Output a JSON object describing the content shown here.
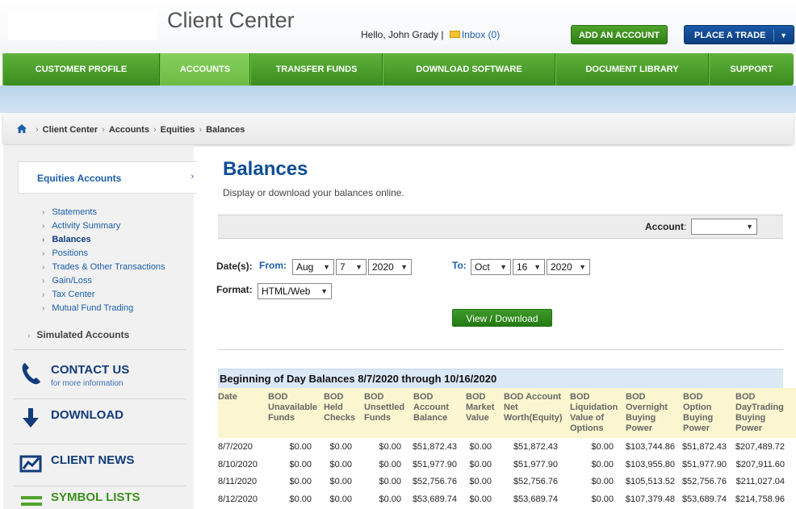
{
  "header": {
    "app_title": "Client Center",
    "welcome": "Hello, John Grady |",
    "inbox_label": "Inbox (0)",
    "add_account_label": "ADD AN ACCOUNT",
    "place_trade_label": "PLACE A TRADE"
  },
  "nav": {
    "items": [
      {
        "label": "CUSTOMER PROFILE"
      },
      {
        "label": "ACCOUNTS"
      },
      {
        "label": "TRANSFER FUNDS"
      },
      {
        "label": "DOWNLOAD SOFTWARE"
      },
      {
        "label": "DOCUMENT LIBRARY"
      },
      {
        "label": "SUPPORT"
      }
    ]
  },
  "breadcrumb": [
    "Client Center",
    "Accounts",
    "Equities",
    "Balances"
  ],
  "sidebar": {
    "section_title": "Equities Accounts",
    "links": [
      "Statements",
      "Activity Summary",
      "Balances",
      "Positions",
      "Trades & Other Transactions",
      "Gain/Loss",
      "Tax Center",
      "Mutual Fund Trading"
    ],
    "simulated": "Simulated Accounts",
    "promos": {
      "contact_title": "CONTACT US",
      "contact_sub": "for more information",
      "download_title": "DOWNLOAD",
      "news_title": "CLIENT NEWS",
      "symbols_title": "SYMBOL LISTS"
    }
  },
  "main": {
    "title": "Balances",
    "subtitle": "Display or download your balances online.",
    "account_label": "Account",
    "account_colon": ":",
    "dates_label": "Date(s):",
    "from_label": "From:",
    "to_label": "To:",
    "from_month": "Aug",
    "from_day": "7",
    "from_year": "2020",
    "to_month": "Oct",
    "to_day": "16",
    "to_year": "2020",
    "format_label": "Format:",
    "format_value": "HTML/Web",
    "view_button": "View / Download"
  },
  "bod": {
    "title": "Beginning of Day Balances 8/7/2020 through 10/16/2020",
    "headers": [
      "Date",
      "BOD\nUnavailable\nFunds",
      "BOD\nHeld\nChecks",
      "BOD\nUnsettled\nFunds",
      "BOD\nAccount\nBalance",
      "BOD\nMarket\nValue",
      "BOD Account\nNet\nWorth(Equity)",
      "BOD\nLiquidation\nValue of\nOptions",
      "BOD\nOvernight\nBuying\nPower",
      "BOD\nOption\nBuying\nPower",
      "BOD\nDayTrading\nBuying\nPower"
    ],
    "rows": [
      [
        "8/7/2020",
        "$0.00",
        "$0.00",
        "$0.00",
        "$51,872.43",
        "$0.00",
        "$51,872.43",
        "$0.00",
        "$103,744.86",
        "$51,872.43",
        "$207,489.72"
      ],
      [
        "8/10/2020",
        "$0.00",
        "$0.00",
        "$0.00",
        "$51,977.90",
        "$0.00",
        "$51,977.90",
        "$0.00",
        "$103,955.80",
        "$51,977.90",
        "$207,911.60"
      ],
      [
        "8/11/2020",
        "$0.00",
        "$0.00",
        "$0.00",
        "$52,756.76",
        "$0.00",
        "$52,756.76",
        "$0.00",
        "$105,513.52",
        "$52,756.76",
        "$211,027.04"
      ],
      [
        "8/12/2020",
        "$0.00",
        "$0.00",
        "$0.00",
        "$53,689.74",
        "$0.00",
        "$53,689.74",
        "$0.00",
        "$107,379.48",
        "$53,689.74",
        "$214,758.96"
      ]
    ]
  },
  "colors": {
    "nav_green": "#4ea42c",
    "brand_blue": "#0d4d96",
    "link_blue": "#1a5ea8",
    "header_yellow": "#fbf6cf"
  }
}
